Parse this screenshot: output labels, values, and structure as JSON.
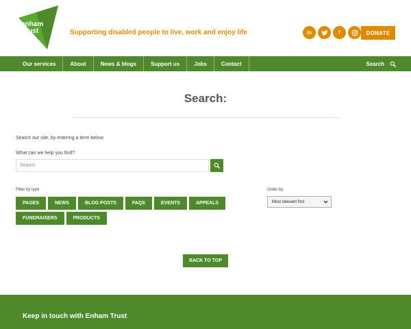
{
  "header": {
    "logo": {
      "line1": "enham",
      "line2": "trust"
    },
    "tagline": "Supporting disabled people to live, work and enjoy life",
    "socials": [
      {
        "icon": "linkedin-icon",
        "glyph": "in"
      },
      {
        "icon": "twitter-icon",
        "glyph": "t"
      },
      {
        "icon": "facebook-icon",
        "glyph": "f"
      },
      {
        "icon": "instagram-icon",
        "glyph": "◎"
      }
    ],
    "donate_label": "DONATE"
  },
  "nav": {
    "items": [
      "Our services",
      "About",
      "News & blogs",
      "Support us",
      "Jobs",
      "Contact"
    ],
    "search_label": "Search"
  },
  "main": {
    "title": "Search:",
    "intro": "Search our site, by entering a term below:",
    "field_label": "What can we help you find?",
    "search_placeholder": "Search",
    "filter_label": "Filter by type",
    "filters_row1": [
      "PAGES",
      "NEWS",
      "BLOG POSTS",
      "FAQS",
      "EVENTS",
      "APPEALS"
    ],
    "filters_row2": [
      "FUNDRAISERS",
      "PRODUCTS"
    ],
    "order_label": "Order by",
    "order_selected": "Most relevant first",
    "back_to_top": "BACK TO TOP"
  },
  "footer": {
    "title": "Keep in touch with Enham Trust"
  },
  "colors": {
    "brand_green": "#4e8a2c",
    "accent_orange": "#e08a00",
    "logo_green": "#5aa832"
  }
}
